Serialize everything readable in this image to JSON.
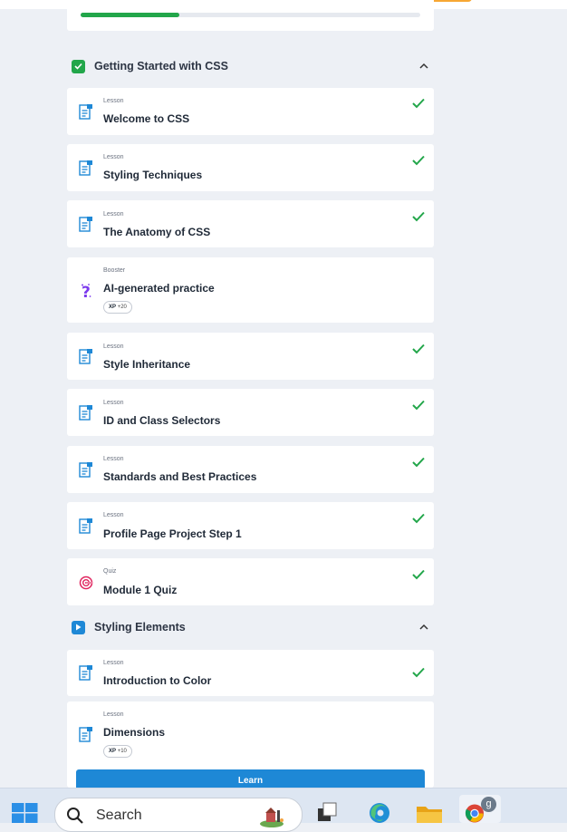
{
  "progress": {
    "fraction": 0.29
  },
  "sections": [
    {
      "title": "Getting Started with CSS",
      "icon": "checkbox-checked-icon",
      "color": "#22a64a"
    },
    {
      "title": "Styling Elements",
      "icon": "play-icon",
      "color": "#1e88d6"
    }
  ],
  "items": [
    {
      "type": "Lesson",
      "title": "Welcome to CSS",
      "done": true,
      "icon": "lesson-icon"
    },
    {
      "type": "Lesson",
      "title": "Styling Techniques",
      "done": true,
      "icon": "lesson-icon"
    },
    {
      "type": "Lesson",
      "title": "The Anatomy of CSS",
      "done": true,
      "icon": "lesson-icon"
    },
    {
      "type": "Booster",
      "title": "AI-generated practice",
      "done": false,
      "icon": "booster-question-icon",
      "xp_label": "XP",
      "xp_value": "+20"
    },
    {
      "type": "Lesson",
      "title": "Style Inheritance",
      "done": true,
      "icon": "lesson-icon"
    },
    {
      "type": "Lesson",
      "title": "ID and Class Selectors",
      "done": true,
      "icon": "lesson-icon"
    },
    {
      "type": "Lesson",
      "title": "Standards and Best Practices",
      "done": true,
      "icon": "lesson-icon"
    },
    {
      "type": "Lesson",
      "title": "Profile Page Project Step 1",
      "done": true,
      "icon": "lesson-icon"
    },
    {
      "type": "Quiz",
      "title": "Module 1 Quiz",
      "done": true,
      "icon": "quiz-target-icon"
    },
    {
      "type": "Lesson",
      "title": "Introduction to Color",
      "done": true,
      "icon": "lesson-icon"
    },
    {
      "type": "Lesson",
      "title": "Dimensions",
      "done": false,
      "icon": "lesson-icon",
      "xp_label": "XP",
      "xp_value": "+10"
    }
  ],
  "learn_button": "Learn",
  "taskbar": {
    "search_placeholder": "Search",
    "chrome_badge": "g",
    "apps": [
      "start-icon",
      "task-view-icon",
      "edge-icon",
      "file-explorer-icon",
      "chrome-icon"
    ]
  },
  "colors": {
    "accent": "#1e88d6",
    "success": "#22a64a",
    "quiz": "#e0245e",
    "booster": "#7c3aed"
  }
}
